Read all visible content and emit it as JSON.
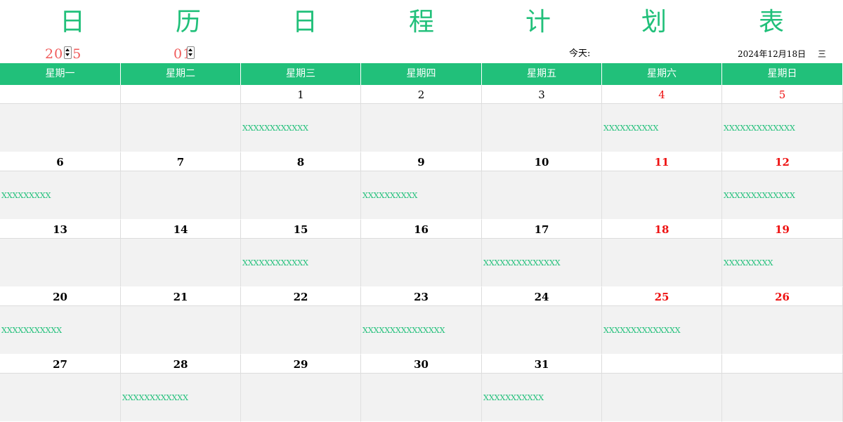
{
  "title_chars": [
    "日",
    "历",
    "日",
    "程",
    "计",
    "划",
    "表"
  ],
  "year": "2025",
  "month": "01",
  "today_label": "今天:",
  "today_date": "2024年12月18日",
  "today_weekday": "三",
  "weekday_headers": [
    "星期一",
    "星期二",
    "星期三",
    "星期四",
    "星期五",
    "星期六",
    "星期日"
  ],
  "weeks": [
    [
      {
        "day": "",
        "note": ""
      },
      {
        "day": "",
        "note": ""
      },
      {
        "day": "1",
        "note": "XXXXXXXXXXXX"
      },
      {
        "day": "2",
        "note": ""
      },
      {
        "day": "3",
        "note": ""
      },
      {
        "day": "4",
        "note": "XXXXXXXXXX"
      },
      {
        "day": "5",
        "note": "XXXXXXXXXXXXX"
      }
    ],
    [
      {
        "day": "6",
        "note": "XXXXXXXXX"
      },
      {
        "day": "7",
        "note": ""
      },
      {
        "day": "8",
        "note": ""
      },
      {
        "day": "9",
        "note": "XXXXXXXXXX"
      },
      {
        "day": "10",
        "note": ""
      },
      {
        "day": "11",
        "note": ""
      },
      {
        "day": "12",
        "note": "XXXXXXXXXXXXX"
      }
    ],
    [
      {
        "day": "13",
        "note": ""
      },
      {
        "day": "14",
        "note": ""
      },
      {
        "day": "15",
        "note": "XXXXXXXXXXXX"
      },
      {
        "day": "16",
        "note": ""
      },
      {
        "day": "17",
        "note": "XXXXXXXXXXXXXX"
      },
      {
        "day": "18",
        "note": ""
      },
      {
        "day": "19",
        "note": "XXXXXXXXX"
      }
    ],
    [
      {
        "day": "20",
        "note": "XXXXXXXXXXX"
      },
      {
        "day": "21",
        "note": ""
      },
      {
        "day": "22",
        "note": ""
      },
      {
        "day": "23",
        "note": "XXXXXXXXXXXXXXX"
      },
      {
        "day": "24",
        "note": ""
      },
      {
        "day": "25",
        "note": "XXXXXXXXXXXXXX"
      },
      {
        "day": "26",
        "note": ""
      }
    ],
    [
      {
        "day": "27",
        "note": ""
      },
      {
        "day": "28",
        "note": "XXXXXXXXXXXX"
      },
      {
        "day": "29",
        "note": ""
      },
      {
        "day": "30",
        "note": ""
      },
      {
        "day": "31",
        "note": "XXXXXXXXXXX"
      },
      {
        "day": "",
        "note": ""
      },
      {
        "day": "",
        "note": ""
      }
    ]
  ],
  "colors": {
    "accent_green": "#21c07a",
    "weekend_red": "#ee1111",
    "spinner_red": "#f05a5a",
    "cell_gray": "#f2f2f2"
  },
  "icons": {
    "spin_up": "spin-up-arrow-icon",
    "spin_down": "spin-down-arrow-icon"
  }
}
